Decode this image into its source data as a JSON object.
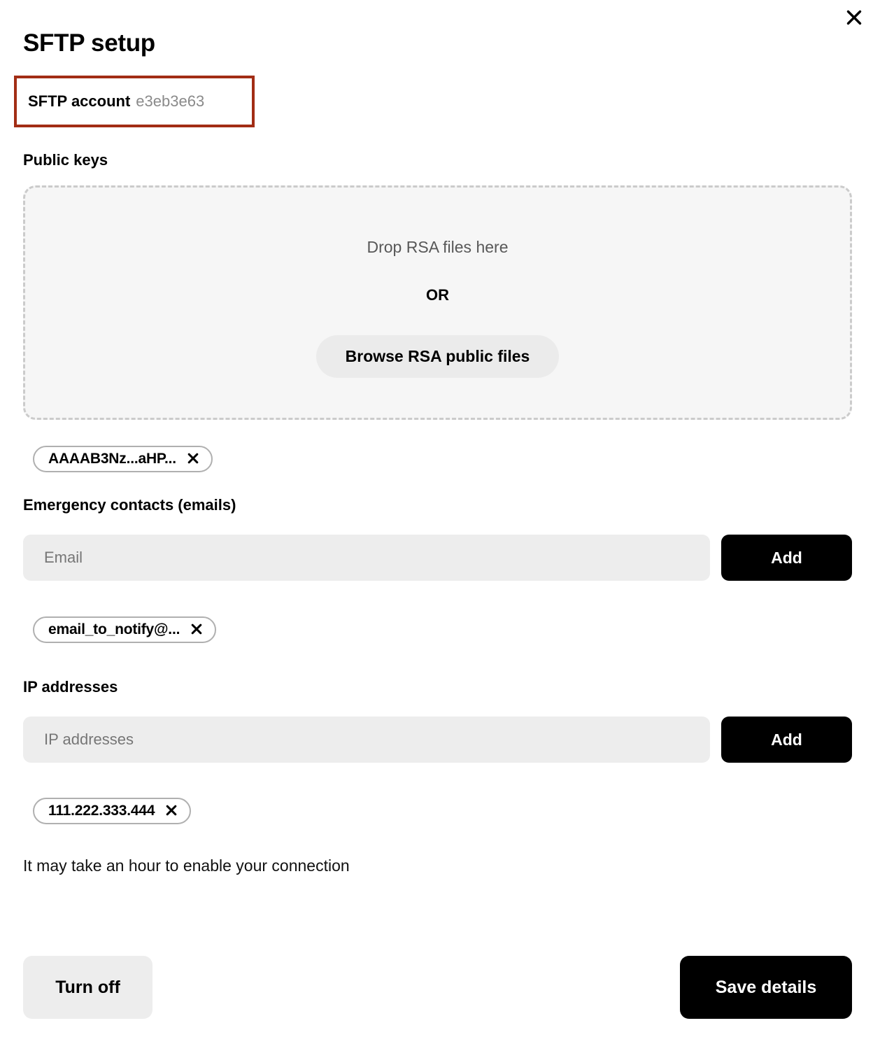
{
  "dialog": {
    "title": "SFTP setup",
    "close_icon": "close-icon"
  },
  "account": {
    "label": "SFTP account",
    "value": "e3eb3e63",
    "highlight_color": "#a22d15"
  },
  "public_keys": {
    "label": "Public keys",
    "dropzone": {
      "hint": "Drop RSA files here",
      "or": "OR",
      "browse_label": "Browse RSA public files"
    },
    "chips": [
      {
        "text": "AAAAB3Nz...aHP...",
        "remove_icon": "close-icon"
      }
    ]
  },
  "emergency_contacts": {
    "label": "Emergency contacts (emails)",
    "input_placeholder": "Email",
    "input_value": "",
    "add_label": "Add",
    "chips": [
      {
        "text": "email_to_notify@...",
        "remove_icon": "close-icon"
      }
    ]
  },
  "ip_addresses": {
    "label": "IP addresses",
    "input_placeholder": "IP addresses",
    "input_value": "",
    "add_label": "Add",
    "chips": [
      {
        "text": "111.222.333.444",
        "remove_icon": "close-icon"
      }
    ]
  },
  "footer": {
    "note": "It may take an hour to enable your connection",
    "turn_off_label": "Turn off",
    "save_label": "Save details"
  }
}
